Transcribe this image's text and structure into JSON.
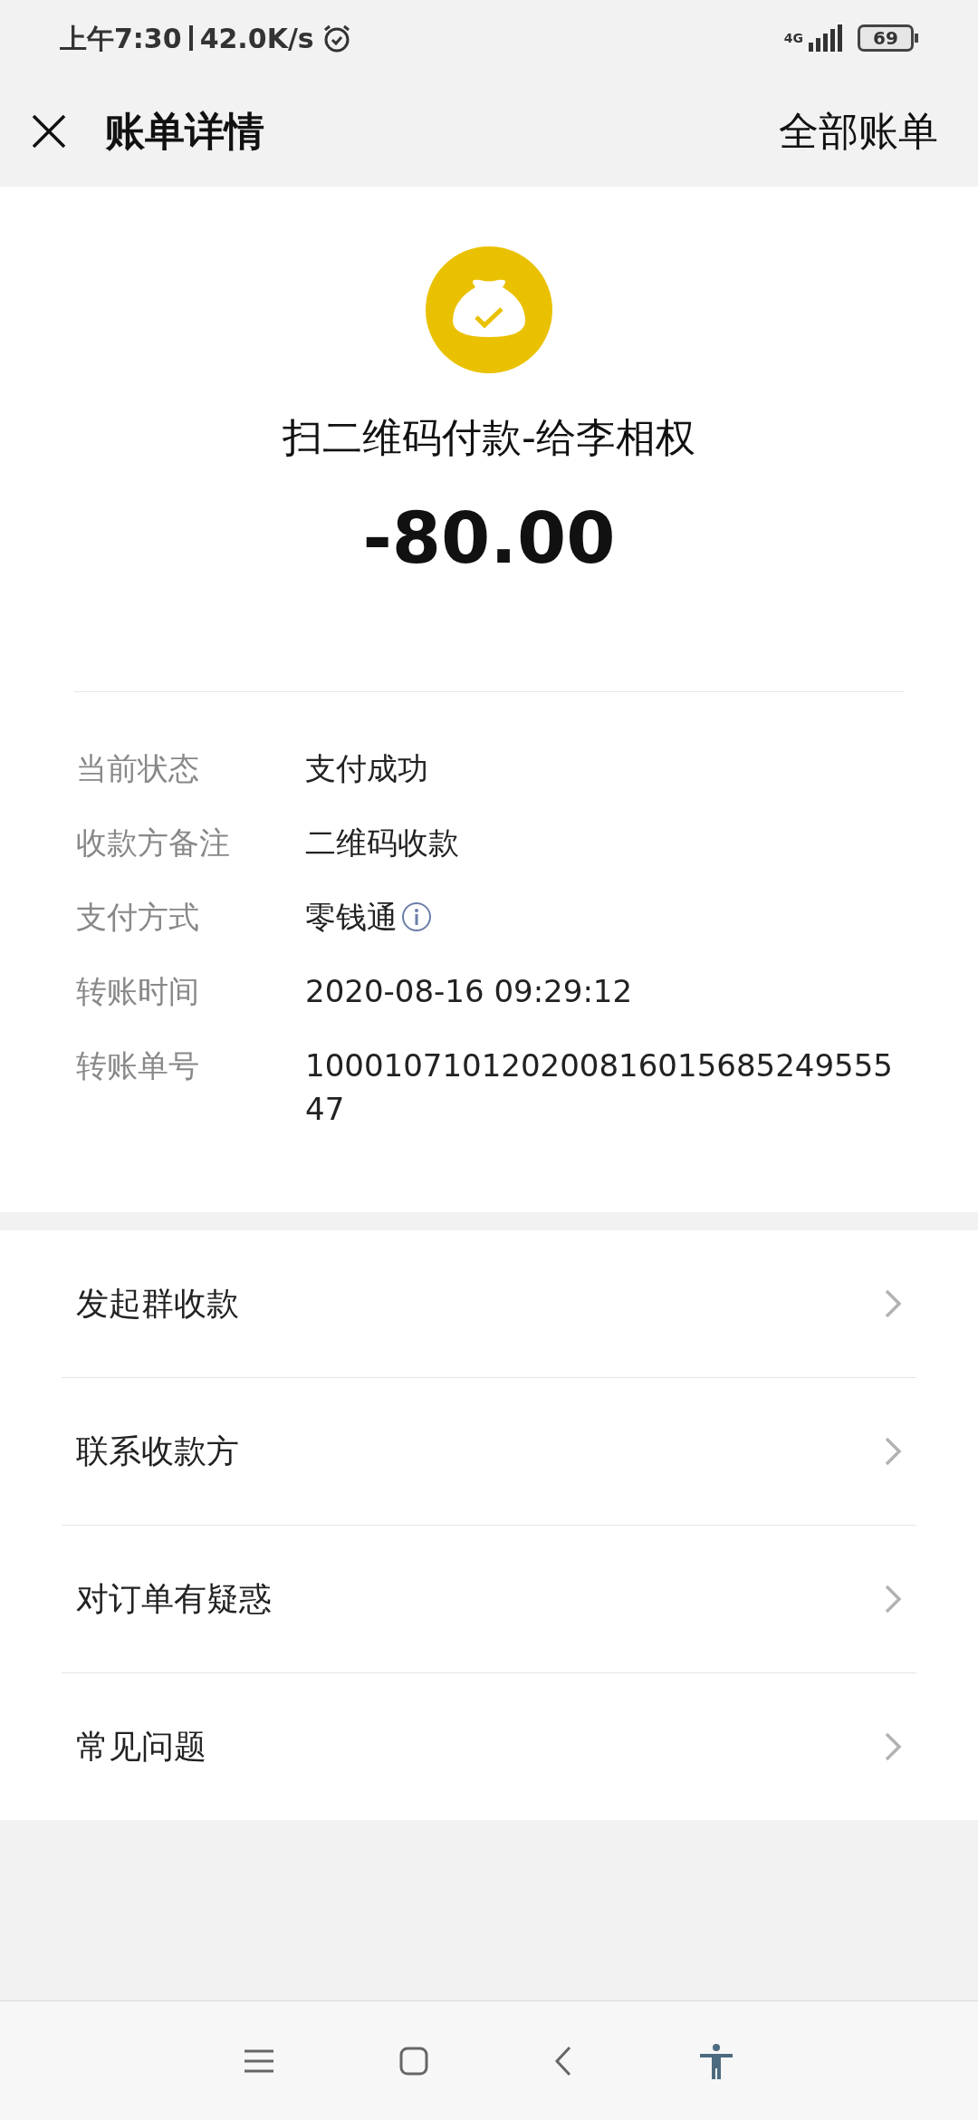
{
  "status_bar": {
    "time": "上午7:30",
    "speed": "42.0K/s",
    "network": "4G",
    "battery": "69"
  },
  "header": {
    "title": "账单详情",
    "action": "全部账单"
  },
  "summary": {
    "title": "扫二维码付款-给李相权",
    "amount": "-80.00"
  },
  "details": [
    {
      "label": "当前状态",
      "value": "支付成功",
      "info": false
    },
    {
      "label": "收款方备注",
      "value": "二维码收款",
      "info": false
    },
    {
      "label": "支付方式",
      "value": "零钱通",
      "info": true
    },
    {
      "label": "转账时间",
      "value": "2020-08-16 09:29:12",
      "info": false
    },
    {
      "label": "转账单号",
      "value": "10001071012020081601568524955547",
      "info": false
    }
  ],
  "actions": [
    "发起群收款",
    "联系收款方",
    "对订单有疑惑",
    "常见问题"
  ]
}
